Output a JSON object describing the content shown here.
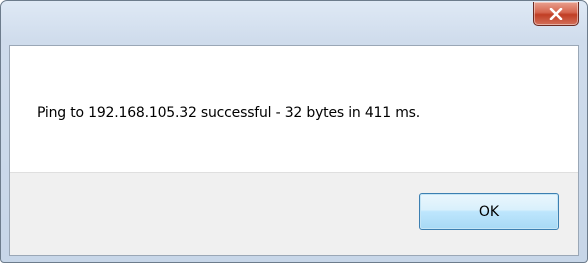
{
  "dialog": {
    "close_icon": "close-icon",
    "message": "Ping to 192.168.105.32 successful - 32 bytes in 411 ms.",
    "ok_label": "OK"
  },
  "colors": {
    "close_button": "#c13e24",
    "ok_button_border": "#3c7fb1",
    "button_area": "#f0f0f0"
  }
}
